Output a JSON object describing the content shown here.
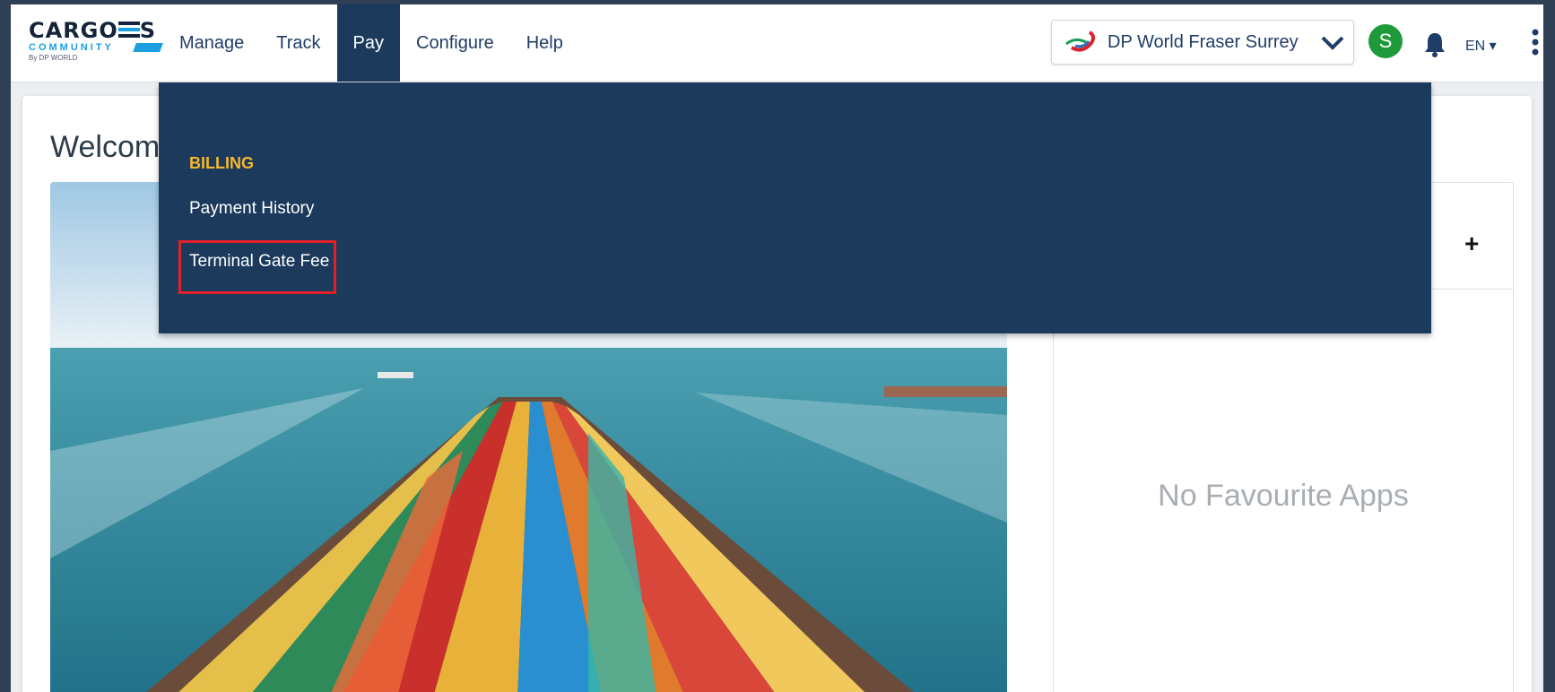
{
  "logo": {
    "line1": "CARGO",
    "line2": "COMMUNITY",
    "line3": "By DP WORLD"
  },
  "nav": {
    "items": [
      "Manage",
      "Track",
      "Pay",
      "Configure",
      "Help"
    ],
    "active": "Pay"
  },
  "header": {
    "terminal": "DP World Fraser Surrey",
    "avatar_initial": "S",
    "language": "EN ▾"
  },
  "page": {
    "welcome": "Welcome"
  },
  "favourites": {
    "empty_text": "No Favourite Apps",
    "add_label": "+"
  },
  "pay_menu": {
    "heading": "BILLING",
    "items": [
      "Payment History",
      "Terminal Gate Fee"
    ],
    "highlighted_item": "Terminal Gate Fee"
  },
  "colors": {
    "navy": "#1b3a5c",
    "heading_yellow": "#f5b82e",
    "highlight_red": "#e3202a",
    "avatar_green": "#1f9a3a"
  }
}
